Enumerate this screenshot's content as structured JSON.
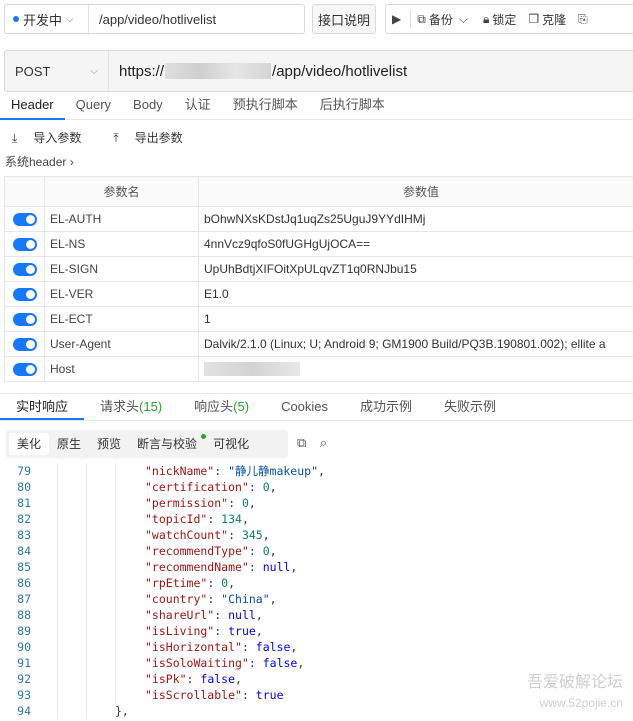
{
  "env": {
    "status": "开发中",
    "path": "/app/video/hotlivelist"
  },
  "doc_button": "接口说明",
  "toolbar": {
    "backup": "备份",
    "lock": "锁定",
    "clone": "克隆"
  },
  "request": {
    "method": "POST",
    "url_prefix": "https://",
    "url_suffix": "/app/video/hotlivelist"
  },
  "req_tabs": [
    "Header",
    "Query",
    "Body",
    "认证",
    "预执行脚本",
    "后执行脚本"
  ],
  "actions": {
    "import": "导入参数",
    "export": "导出参数"
  },
  "system_header": "系统header",
  "params": {
    "col_name": "参数名",
    "col_value": "参数值",
    "rows": [
      {
        "name": "EL-AUTH",
        "value": "bOhwNXsKDstJq1uqZs25UguJ9YYdIHMj"
      },
      {
        "name": "EL-NS",
        "value": "4nnVcz9qfoS0fUGHgUjOCA=="
      },
      {
        "name": "EL-SIGN",
        "value": "UpUhBdtjXIFOitXpULqvZT1q0RNJbu15"
      },
      {
        "name": "EL-VER",
        "value": "E1.0"
      },
      {
        "name": "EL-ECT",
        "value": "1"
      },
      {
        "name": "User-Agent",
        "value": "Dalvik/2.1.0 (Linux; U; Android 9; GM1900 Build/PQ3B.190801.002); ellite a"
      },
      {
        "name": "Host",
        "value": ""
      }
    ]
  },
  "resp_tabs": [
    {
      "label": "实时响应",
      "count": ""
    },
    {
      "label": "请求头",
      "count": "(15)"
    },
    {
      "label": "响应头",
      "count": "(5)"
    },
    {
      "label": "Cookies",
      "count": ""
    },
    {
      "label": "成功示例",
      "count": ""
    },
    {
      "label": "失败示例",
      "count": ""
    }
  ],
  "view_modes": [
    "美化",
    "原生",
    "预览",
    "断言与校验",
    "可视化"
  ],
  "code_lines": [
    {
      "n": "79",
      "key": "\"nickName\"",
      "val": "\"静儿静makeup\"",
      "t": "s"
    },
    {
      "n": "80",
      "key": "\"certification\"",
      "val": "0",
      "t": "n"
    },
    {
      "n": "81",
      "key": "\"permission\"",
      "val": "0",
      "t": "n"
    },
    {
      "n": "82",
      "key": "\"topicId\"",
      "val": "134",
      "t": "n"
    },
    {
      "n": "83",
      "key": "\"watchCount\"",
      "val": "345",
      "t": "n"
    },
    {
      "n": "84",
      "key": "\"recommendType\"",
      "val": "0",
      "t": "n"
    },
    {
      "n": "85",
      "key": "\"recommendName\"",
      "val": "null",
      "t": "b"
    },
    {
      "n": "86",
      "key": "\"rpEtime\"",
      "val": "0",
      "t": "n"
    },
    {
      "n": "87",
      "key": "\"country\"",
      "val": "\"China\"",
      "t": "s"
    },
    {
      "n": "88",
      "key": "\"shareUrl\"",
      "val": "null",
      "t": "b"
    },
    {
      "n": "89",
      "key": "\"isLiving\"",
      "val": "true",
      "t": "b"
    },
    {
      "n": "90",
      "key": "\"isHorizontal\"",
      "val": "false",
      "t": "b"
    },
    {
      "n": "91",
      "key": "\"isSoloWaiting\"",
      "val": "false",
      "t": "b"
    },
    {
      "n": "92",
      "key": "\"isPk\"",
      "val": "false",
      "t": "b"
    },
    {
      "n": "93",
      "key": "\"isScrollable\"",
      "val": "true",
      "t": "b",
      "last": true
    }
  ],
  "closing_line": {
    "n": "94",
    "text": "},"
  },
  "watermark": {
    "line1": "吾爱破解论坛",
    "line2": "www.52pojie.cn"
  }
}
